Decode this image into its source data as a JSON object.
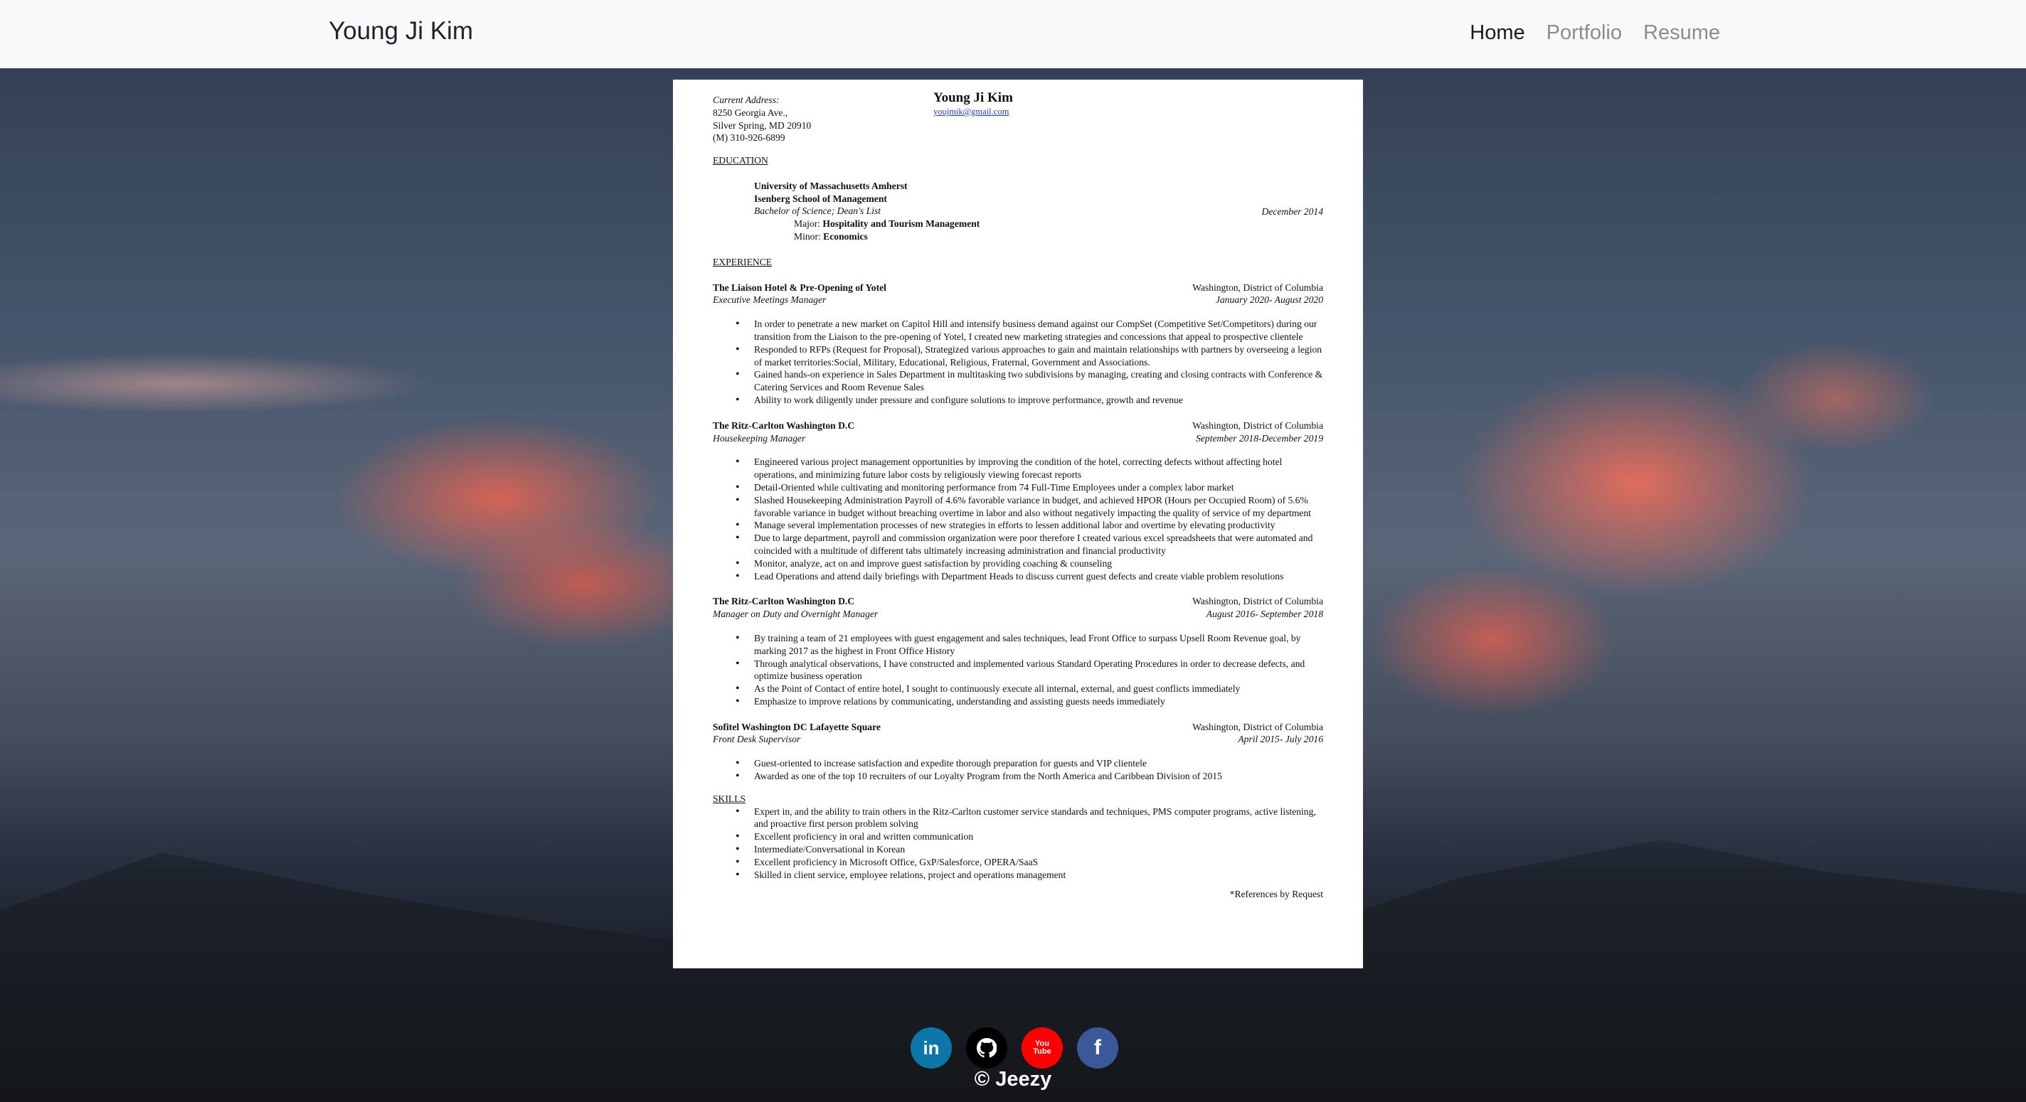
{
  "nav": {
    "brand": "Young Ji Kim",
    "links": [
      "Home",
      "Portfolio",
      "Resume"
    ],
    "active": "Home"
  },
  "resume": {
    "address_label": "Current Address:",
    "address": [
      "8250 Georgia Ave.,",
      "Silver Spring, MD 20910",
      "(M) 310-926-6899"
    ],
    "name": "Young Ji Kim",
    "email": "youjmik@gmail.com",
    "education_heading": "EDUCATION",
    "education": {
      "school": "University of Massachusetts Amherst",
      "college": "Isenberg School of Management",
      "degree": "Bachelor of Science; Dean's List",
      "date": "December 2014",
      "major_label": "Major:",
      "major": "Hospitality and Tourism Management",
      "minor_label": "Minor:",
      "minor": "Economics"
    },
    "experience_heading": "EXPERIENCE",
    "jobs": [
      {
        "company": "The Liaison Hotel & Pre-Opening of Yotel",
        "location": "Washington, District of Columbia",
        "title": "Executive Meetings Manager",
        "dates": "January 2020- August 2020",
        "bullets": [
          "In order to penetrate a new market on Capitol Hill and intensify business demand against our CompSet (Competitive Set/Competitors) during our transition from the Liaison to the pre-opening of Yotel,  I created new marketing strategies and concessions that appeal to prospective clientele",
          "Responded to RFPs (Request for Proposal), Strategized various approaches to gain and maintain relationships with partners by overseeing a legion of market territories:Social, Military, Educational, Religious, Fraternal, Government and Associations.",
          "Gained hands-on experience in Sales Department in multitasking two subdivisions by managing, creating and closing contracts with Conference & Catering Services and Room Revenue Sales",
          "Ability to work diligently under pressure and configure solutions to improve performance, growth and revenue"
        ]
      },
      {
        "company": "The Ritz-Carlton Washington D.C",
        "location": "Washington, District of Columbia",
        "title": "Housekeeping Manager",
        "dates": "September 2018-December 2019",
        "bullets": [
          "Engineered various project management opportunities by improving the condition of the hotel, correcting defects without affecting hotel operations, and minimizing future labor costs by religiously viewing forecast reports",
          "Detail-Oriented while cultivating and monitoring performance from 74 Full-Time Employees under a complex labor market",
          "Slashed Housekeeping Administration Payroll of 4.6% favorable variance in budget, and achieved HPOR (Hours per Occupied Room) of 5.6% favorable variance in budget without breaching overtime in labor and also without negatively impacting the quality of service of my department",
          "Manage several implementation processes of new strategies in efforts to lessen additional labor and overtime by elevating productivity",
          "Due to large department, payroll and commission organization were poor therefore I created various excel spreadsheets that were automated and coincided with a multitude of different tabs ultimately increasing administration and financial productivity",
          "Monitor, analyze, act on and improve guest satisfaction by providing coaching & counseling",
          "Lead Operations and attend daily briefings with Department Heads to discuss current guest defects and create viable problem resolutions"
        ]
      },
      {
        "company": "The Ritz-Carlton Washington D.C",
        "location": "Washington, District of Columbia",
        "title": "Manager on Duty and Overnight Manager",
        "dates": "August 2016- September 2018",
        "bullets": [
          "By training a team of 21 employees with guest engagement and sales techniques, lead Front Office to surpass Upsell Room Revenue goal, by marking 2017 as the highest in Front Office History",
          "Through analytical observations, I have constructed and implemented various Standard Operating Procedures in order to decrease defects, and optimize business operation",
          "As the Point of Contact of entire hotel, I sought to continuously execute all internal, external, and guest conflicts immediately",
          "Emphasize to improve relations by communicating, understanding and assisting guests needs immediately"
        ]
      },
      {
        "company": "Sofitel Washington DC Lafayette Square",
        "location": "Washington, District of Columbia",
        "title": "Front Desk Supervisor",
        "dates": "April 2015- July 2016",
        "bullets": [
          "Guest-oriented to increase satisfaction and expedite thorough preparation for guests and VIP clientele",
          "Awarded as one of the top 10 recruiters of our Loyalty Program from the North America and Caribbean Division of 2015"
        ]
      }
    ],
    "skills_heading": "SKILLS",
    "skills": [
      "Expert in, and the ability to train others in the Ritz-Carlton customer service standards and techniques, PMS computer programs, active listening, and proactive first person problem solving",
      "Excellent proficiency in oral and written communication",
      "Intermediate/Conversational in Korean",
      "Excellent proficiency in Microsoft Office, GxP/Salesforce, OPERA/SaaS",
      "Skilled in client service, employee relations, project and operations management"
    ],
    "references": "*References by Request"
  },
  "footer": {
    "social": [
      {
        "name": "linkedin",
        "label": "in",
        "color": "#0a77a8"
      },
      {
        "name": "github",
        "label": "",
        "color": "#000000"
      },
      {
        "name": "youtube",
        "label": "You Tube",
        "color": "#ff0000"
      },
      {
        "name": "facebook",
        "label": "f",
        "color": "#3b5998"
      }
    ],
    "copyright": "© Jeezy"
  }
}
